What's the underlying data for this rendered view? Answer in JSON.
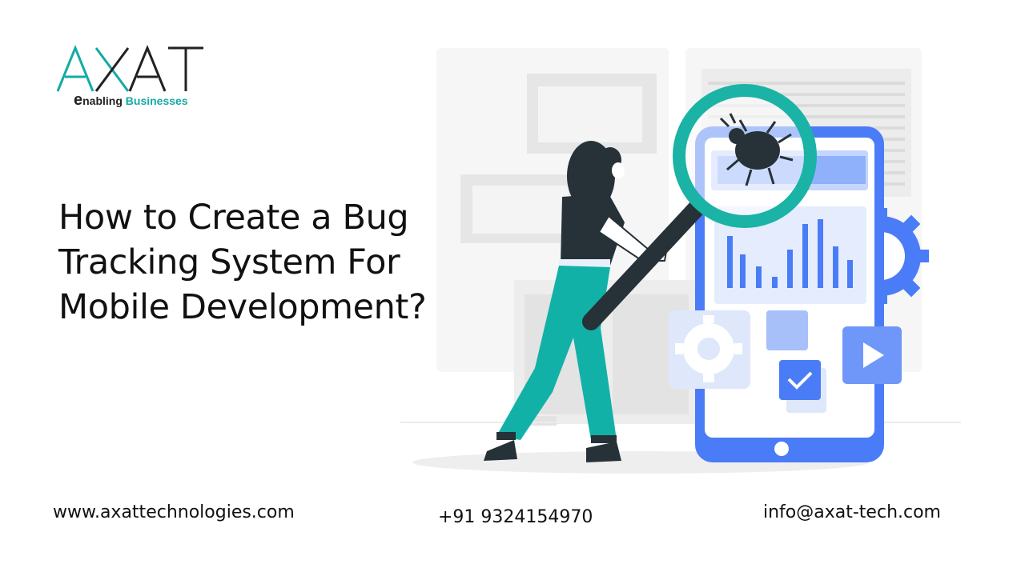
{
  "brand": {
    "logo_text": "AXAT",
    "tagline_e": "e",
    "tagline_word1": "nabling",
    "tagline_word2": "Businesses",
    "colors": {
      "teal": "#15aaa6",
      "dark": "#222222"
    }
  },
  "headline": "How to Create a Bug Tracking System For Mobile Development?",
  "illustration": {
    "icons": [
      "bug-icon",
      "magnifying-glass-icon",
      "gear-icon",
      "checkbox-icon",
      "play-icon",
      "bar-chart-icon"
    ],
    "colors": {
      "phone_blue": "#4a7cf7",
      "glass_teal": "#1ab3a6",
      "light_blue": "#c5d6fc",
      "person_dark": "#263238"
    }
  },
  "footer": {
    "website": "www.axattechnologies.com",
    "phone": "+91 9324154970",
    "email": "info@axat-tech.com"
  }
}
